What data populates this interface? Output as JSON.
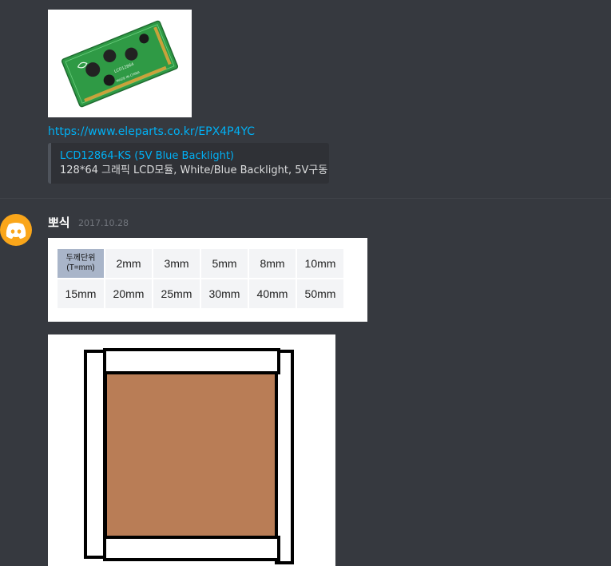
{
  "first_message": {
    "image": {
      "alt": "LCD12864 module photo",
      "board_color": "#2f9a45"
    },
    "link_text": "https://www.eleparts.co.kr/EPX4P4YC",
    "embed": {
      "title": "LCD12864-KS (5V Blue Backlight)",
      "description": "128*64 그래픽 LCD모듈, White/Blue Backlight, 5V구동"
    }
  },
  "second_message": {
    "avatar_icon": "discord-icon",
    "avatar_color": "#faa61a",
    "username": "뽀식",
    "timestamp": "2017.10.28",
    "thickness_table": {
      "header_line1": "두께단위",
      "header_line2": "(T=mm)",
      "row1": [
        "2mm",
        "3mm",
        "5mm",
        "8mm",
        "10mm"
      ],
      "row2": [
        "15mm",
        "20mm",
        "25mm",
        "30mm",
        "40mm",
        "50mm"
      ]
    },
    "drawing": {
      "fill_color": "#b97d56",
      "outline_color": "#000000"
    }
  },
  "colors": {
    "background": "#36393f",
    "link": "#00b0f4",
    "embed_bg": "#2f3136"
  }
}
